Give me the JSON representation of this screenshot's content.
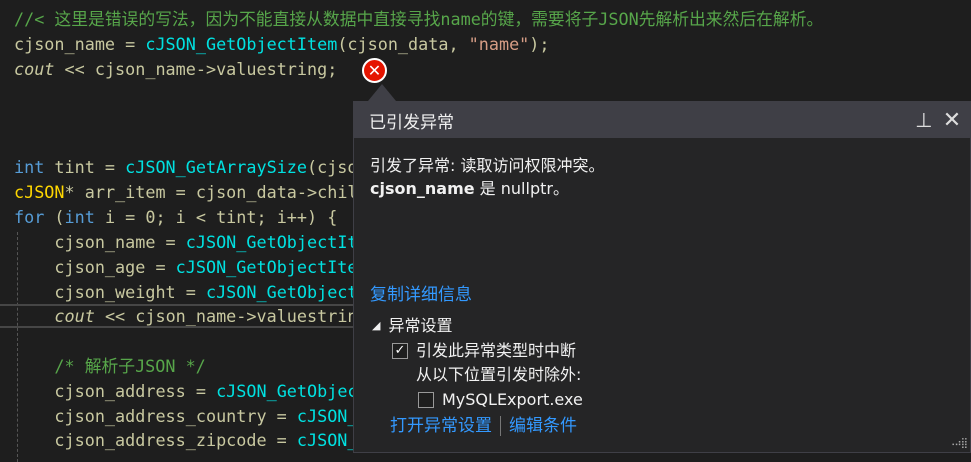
{
  "code": {
    "l1": "//< 这里是错误的写法，因为不能直接从数据中直接寻找name的键，需要将子JSON先解析出来然后在解析。",
    "l2a": "cjson_name = ",
    "l2b": "cJSON_GetObjectItem",
    "l2c": "(cjson_data, ",
    "l2d": "\"name\"",
    "l2e": ");",
    "l3a": "cout",
    "l3b": " << cjson_name->valuestring;",
    "l4a": "int",
    "l4b": " tint = ",
    "l4c": "cJSON_GetArraySize",
    "l4d": "(cjson_data);",
    "l5a": "cJSON",
    "l5b": "* arr_item = cjson_data->child;",
    "l6a": "for",
    "l6b": " (",
    "l6c": "int",
    "l6d": " i = 0; i < tint; i++) {",
    "l7a": "    cjson_name = ",
    "l7b": "cJSON_GetObjectItem",
    "l8a": "    cjson_age = ",
    "l8b": "cJSON_GetObjectItem",
    "l9a": "    cjson_weight = ",
    "l9b": "cJSON_GetObjectItem",
    "l10a": "    ",
    "l10b": "cout",
    "l10c": " << cjson_name->valuestring;",
    "l11": "    /* 解析子JSON */",
    "l12a": "    cjson_address = ",
    "l12b": "cJSON_GetObjectItem",
    "l13a": "    cjson_address_country = ",
    "l13b": "cJSON_GetObjectItem",
    "l14a": "    cjson_address_zipcode = ",
    "l14b": "cJSON_GetObjectItem"
  },
  "popup": {
    "title": "已引发异常",
    "message_line1": "引发了异常: 读取访问权限冲突。",
    "message_var": "cjson_name",
    "message_line2_rest": " 是 nullptr。",
    "copy_details": "复制详细信息",
    "settings_header": "异常设置",
    "break_label": "引发此异常类型时中断",
    "break_checked": true,
    "except_label": "从以下位置引发时除外:",
    "module_label": "MySQLExport.exe",
    "module_checked": false,
    "open_settings": "打开异常设置",
    "edit_conditions": "编辑条件"
  }
}
